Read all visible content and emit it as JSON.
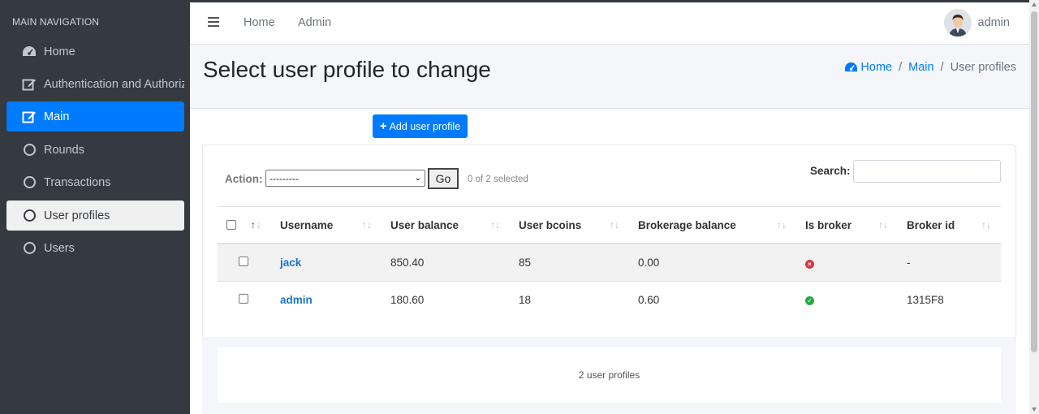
{
  "sidebar": {
    "header": "MAIN NAVIGATION",
    "items": [
      {
        "label": "Home",
        "icon": "dashboard-icon"
      },
      {
        "label": "Authentication and Authoriz",
        "icon": "edit-icon"
      },
      {
        "label": "Main",
        "icon": "edit-icon",
        "active": true
      },
      {
        "label": "Rounds",
        "icon": "circle-icon"
      },
      {
        "label": "Transactions",
        "icon": "circle-icon"
      },
      {
        "label": "User profiles",
        "icon": "circle-icon",
        "selected": true
      },
      {
        "label": "Users",
        "icon": "circle-icon"
      }
    ]
  },
  "topbar": {
    "links": [
      "Home",
      "Admin"
    ],
    "user": "admin"
  },
  "page": {
    "title": "Select user profile to change",
    "breadcrumb": [
      "Home",
      "Main",
      "User profiles"
    ]
  },
  "toolbar": {
    "add_label": "Add user profile",
    "action_label": "Action:",
    "action_value": "---------",
    "go_label": "Go",
    "selected_text": "0 of 2 selected",
    "search_label": "Search:"
  },
  "table": {
    "headers": [
      "Username",
      "User balance",
      "User bcoins",
      "Brokerage balance",
      "Is broker",
      "Broker id"
    ],
    "rows": [
      {
        "username": "jack",
        "balance": "850.40",
        "bcoins": "85",
        "brokerage": "0.00",
        "is_broker": false,
        "broker_id": "-"
      },
      {
        "username": "admin",
        "balance": "180.60",
        "bcoins": "18",
        "brokerage": "0.60",
        "is_broker": true,
        "broker_id": "1315F8"
      }
    ],
    "footer": "2 user profiles"
  },
  "colors": {
    "sidebar_bg": "#343a40",
    "accent": "#007bff",
    "false_icon": "#dc3545",
    "true_icon": "#28a745"
  }
}
